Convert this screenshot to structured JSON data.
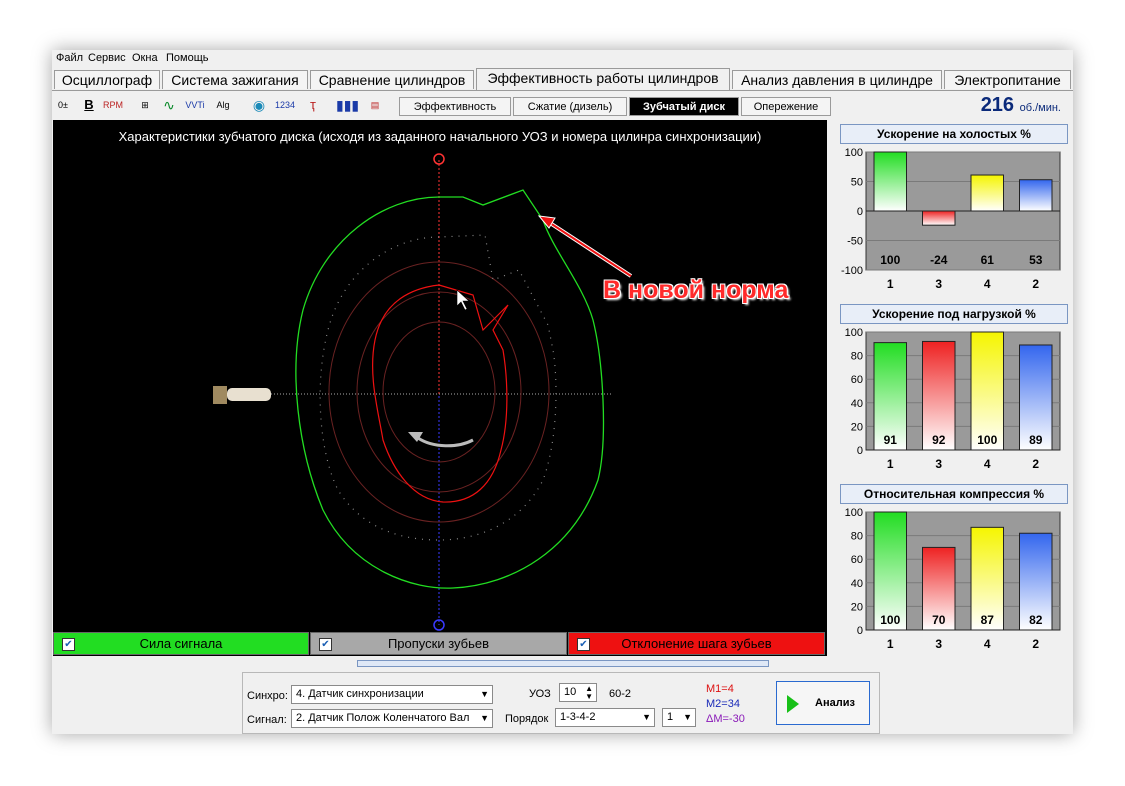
{
  "menu": [
    "Файл",
    "Сервис",
    "Окна",
    "Помощь"
  ],
  "tabs": [
    {
      "label": "Осциллограф",
      "active": false
    },
    {
      "label": "Система зажигания",
      "active": false
    },
    {
      "label": "Сравнение цилиндров",
      "active": false
    },
    {
      "label": "Эффективность работы цилиндров",
      "active": true
    },
    {
      "label": "Анализ давления в цилиндре",
      "active": false
    },
    {
      "label": "Электропитание",
      "active": false
    }
  ],
  "toolbar_icons": [
    "zero-icon",
    "bold-b-icon",
    "rpm-icon",
    "scale-icon",
    "wave-icon",
    "vvti-icon",
    "alg-icon",
    "sensor-icon",
    "order-icon",
    "filter-icon",
    "bars-icon",
    "doc-icon"
  ],
  "subtabs": [
    {
      "label": "Эффективность",
      "active": false
    },
    {
      "label": "Сжатие (дизель)",
      "active": false
    },
    {
      "label": "Зубчатый диск",
      "active": true
    },
    {
      "label": "Опережение",
      "active": false
    }
  ],
  "rpm": {
    "value": "216",
    "unit": "об./мин."
  },
  "plot": {
    "title": "Характеристики зубчатого диска (исходя из заданного начального УОЗ и номера цилинра синхронизации)",
    "annotation": "В новой норма"
  },
  "legend_buttons": [
    {
      "label": "Сила сигнала",
      "color": "#1fd11f",
      "checked": true
    },
    {
      "label": "Пропуски зубьев",
      "color": "#a8a8a8",
      "checked": true
    },
    {
      "label": "Отклонение шага зубьев",
      "color": "#ee1111",
      "checked": true
    }
  ],
  "charts": [
    {
      "title": "Ускорение на холостых %",
      "ylim": [
        -100,
        100
      ],
      "yticks": [
        "100",
        "50",
        "0",
        "-50",
        "-100"
      ],
      "categories": [
        "1",
        "3",
        "4",
        "2"
      ],
      "values": [
        100,
        -24,
        61,
        53
      ],
      "colors": [
        "#22dd22",
        "#ee2222",
        "#f5f500",
        "#3366ee"
      ]
    },
    {
      "title": "Ускорение под нагрузкой %",
      "ylim": [
        0,
        100
      ],
      "yticks": [
        "100",
        "80",
        "60",
        "40",
        "20",
        "0"
      ],
      "categories": [
        "1",
        "3",
        "4",
        "2"
      ],
      "values": [
        91,
        92,
        100,
        89
      ],
      "colors": [
        "#22dd22",
        "#ee2222",
        "#f5f500",
        "#3366ee"
      ]
    },
    {
      "title": "Относительная компрессия %",
      "ylim": [
        0,
        100
      ],
      "yticks": [
        "100",
        "80",
        "60",
        "40",
        "20",
        "0"
      ],
      "categories": [
        "1",
        "3",
        "4",
        "2"
      ],
      "values": [
        100,
        70,
        87,
        82
      ],
      "colors": [
        "#22dd22",
        "#ee2222",
        "#f5f500",
        "#3366ee"
      ]
    }
  ],
  "bottom": {
    "sync_label": "Синхро:",
    "sync_value": "4.  Датчик синхронизации",
    "signal_label": "Сигнал:",
    "signal_value": "2.  Датчик Полож Коленчатого Вал",
    "uoz_label": "УОЗ",
    "uoz_value": "10",
    "teeth": "60-2",
    "order_label": "Порядок",
    "order_value": "1-3-4-2",
    "cyl_value": "1",
    "m1": "M1=4",
    "m2": "M2=34",
    "dm": "ΔM=-30",
    "analyze": "Анализ"
  },
  "chart_data": [
    {
      "type": "bar",
      "title": "Ускорение на холостых %",
      "categories": [
        "1",
        "3",
        "4",
        "2"
      ],
      "values": [
        100,
        -24,
        61,
        53
      ],
      "ylim": [
        -100,
        100
      ]
    },
    {
      "type": "bar",
      "title": "Ускорение под нагрузкой %",
      "categories": [
        "1",
        "3",
        "4",
        "2"
      ],
      "values": [
        91,
        92,
        100,
        89
      ],
      "ylim": [
        0,
        100
      ]
    },
    {
      "type": "bar",
      "title": "Относительная компрессия %",
      "categories": [
        "1",
        "3",
        "4",
        "2"
      ],
      "values": [
        100,
        70,
        87,
        82
      ],
      "ylim": [
        0,
        100
      ]
    }
  ]
}
